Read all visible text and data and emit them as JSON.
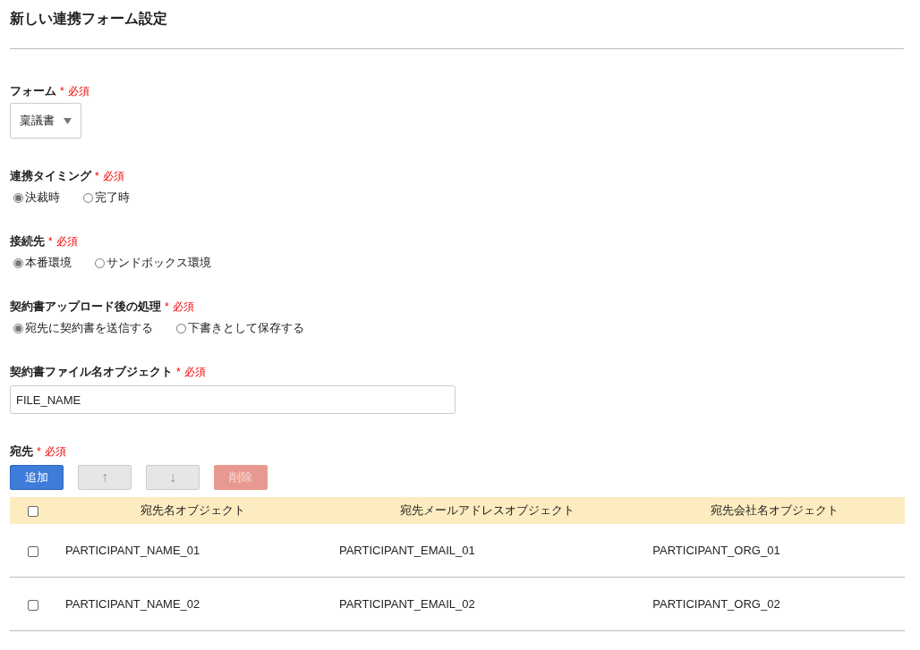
{
  "title": "新しい連携フォーム設定",
  "fields": [
    {
      "kind": "select",
      "label": "フォーム",
      "required_mark": "*",
      "required_text": "必須",
      "value": "稟議書"
    },
    {
      "kind": "radio",
      "label": "連携タイミング",
      "required_mark": "*",
      "required_text": "必須",
      "options": [
        {
          "label": "決裁時",
          "selected": true
        },
        {
          "label": "完了時",
          "selected": false
        }
      ]
    },
    {
      "kind": "radio",
      "label": "接続先",
      "required_mark": "*",
      "required_text": "必須",
      "options": [
        {
          "label": "本番環境",
          "selected": true
        },
        {
          "label": "サンドボックス環境",
          "selected": false
        }
      ]
    },
    {
      "kind": "radio",
      "label": "契約書アップロード後の処理",
      "required_mark": "*",
      "required_text": "必須",
      "options": [
        {
          "label": "宛先に契約書を送信する",
          "selected": true
        },
        {
          "label": "下書きとして保存する",
          "selected": false
        }
      ]
    },
    {
      "kind": "text",
      "label": "契約書ファイル名オブジェクト",
      "required_mark": "*",
      "required_text": "必須",
      "value": "FILE_NAME"
    }
  ],
  "recipients": {
    "label": "宛先",
    "required_mark": "*",
    "required_text": "必須",
    "buttons": [
      {
        "label": "追加",
        "kind": "primary",
        "disabled": false
      },
      {
        "label": "↑",
        "kind": "default",
        "disabled": true
      },
      {
        "label": "↓",
        "kind": "default",
        "disabled": true
      },
      {
        "label": "削除",
        "kind": "danger",
        "disabled": true
      }
    ],
    "table": {
      "header_checked": false,
      "columns": [
        "宛先名オブジェクト",
        "宛先メールアドレスオブジェクト",
        "宛先会社名オブジェクト"
      ],
      "rows": [
        {
          "checked": false,
          "cells": [
            "PARTICIPANT_NAME_01",
            "PARTICIPANT_EMAIL_01",
            "PARTICIPANT_ORG_01"
          ]
        },
        {
          "checked": false,
          "cells": [
            "PARTICIPANT_NAME_02",
            "PARTICIPANT_EMAIL_02",
            "PARTICIPANT_ORG_02"
          ]
        }
      ]
    }
  }
}
